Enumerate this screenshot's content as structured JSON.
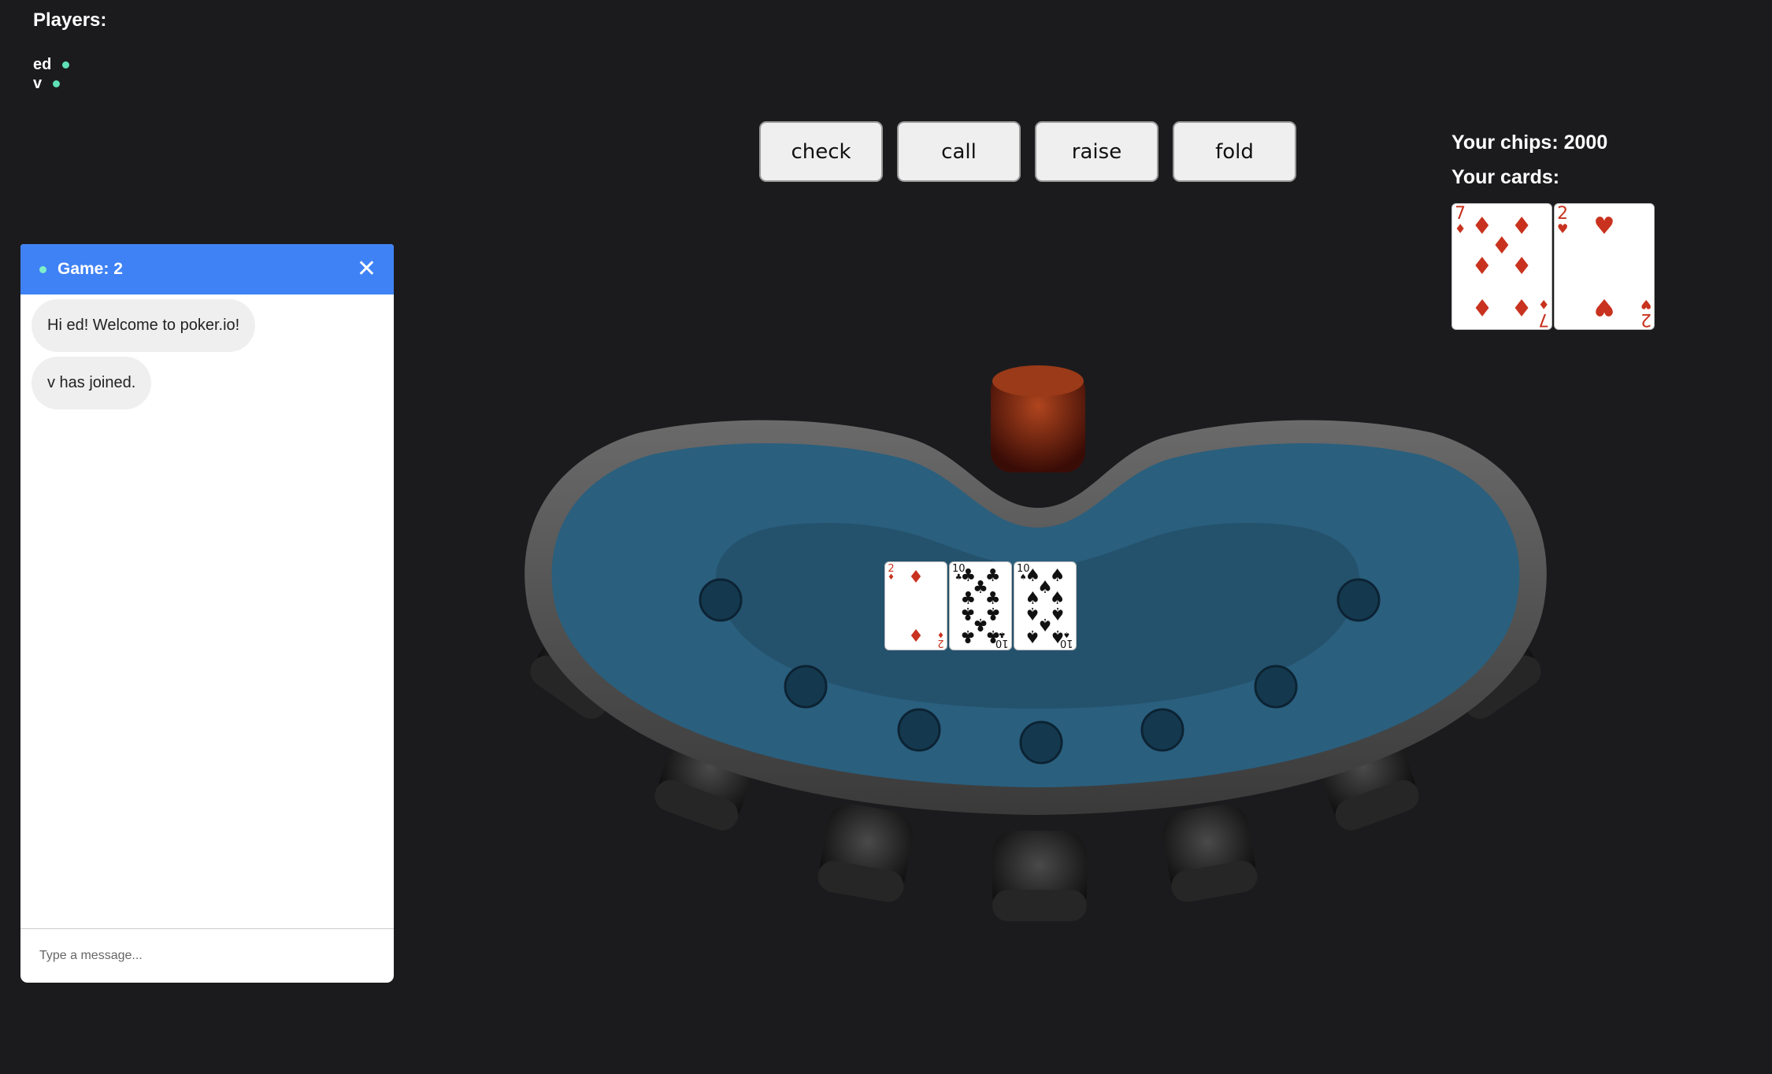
{
  "players": {
    "heading": "Players:",
    "list": [
      {
        "name": "ed",
        "status": "online"
      },
      {
        "name": "v",
        "status": "online"
      }
    ]
  },
  "actions": {
    "check": "check",
    "call": "call",
    "raise": "raise",
    "fold": "fold"
  },
  "me": {
    "chips_text": "Your chips: 2000",
    "cards_label": "Your cards:",
    "cards": [
      {
        "rank": "7",
        "suit": "diamonds"
      },
      {
        "rank": "2",
        "suit": "hearts"
      }
    ]
  },
  "board": {
    "cards": [
      {
        "rank": "2",
        "suit": "diamonds"
      },
      {
        "rank": "10",
        "suit": "clubs"
      },
      {
        "rank": "10",
        "suit": "spades"
      }
    ]
  },
  "chat": {
    "title": "Game: 2",
    "close_icon": "close-icon",
    "messages": [
      "Hi ed! Welcome to poker.io!",
      "v has joined."
    ],
    "input_placeholder": "Type a message..."
  },
  "colors": {
    "background": "#1b1b1d",
    "chat_header": "#3f82f5",
    "online_dot": "#5fe0b5",
    "felt": "#2a5f7e"
  }
}
